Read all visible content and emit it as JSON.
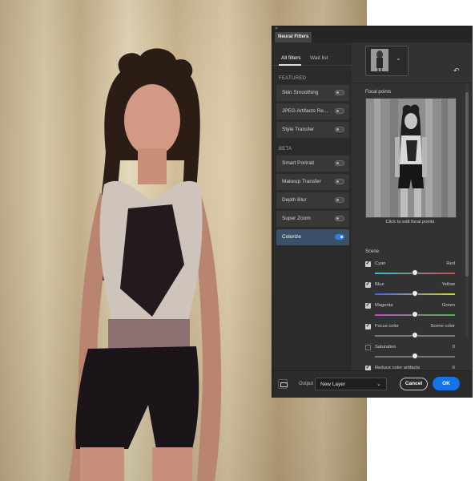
{
  "dialog": {
    "title": "Neural Filters"
  },
  "tabs": [
    {
      "label": "All filters",
      "active": true
    },
    {
      "label": "Wait list",
      "active": false
    }
  ],
  "sections": {
    "featured": "FEATURED",
    "beta": "BETA"
  },
  "featured_filters": [
    {
      "label": "Skin Smoothing",
      "on": false
    },
    {
      "label": "JPEG Artifacts Re...",
      "on": false
    },
    {
      "label": "Style Transfer",
      "on": false
    }
  ],
  "beta_filters": [
    {
      "label": "Smart Portrait",
      "on": false
    },
    {
      "label": "Makeup Transfer",
      "on": false
    },
    {
      "label": "Depth Blur",
      "on": false
    },
    {
      "label": "Super Zoom",
      "on": false
    },
    {
      "label": "Colorize",
      "on": true
    }
  ],
  "right": {
    "focal_points_label": "Focal points",
    "focal_caption": "Click to edit focal points",
    "scene_label": "Scene"
  },
  "params": [
    {
      "checked": true,
      "left": "Cyan",
      "right": "Red",
      "value_fraction": 0.5
    },
    {
      "checked": true,
      "left": "Blue",
      "right": "Yellow",
      "value_fraction": 0.5
    },
    {
      "checked": true,
      "left": "Magenta",
      "right": "Green",
      "value_fraction": 0.5
    },
    {
      "checked": true,
      "left": "Focus color",
      "right": "Scene color",
      "value_fraction": 0.5
    },
    {
      "checked": false,
      "left": "Saturation",
      "right": "0",
      "value_fraction": 0.5
    },
    {
      "checked": true,
      "left": "Reduce color artifacts",
      "right": "6",
      "value_fraction": 0.5
    }
  ],
  "footer": {
    "output_label": "Output",
    "output_value": "New Layer",
    "cancel_label": "Cancel",
    "ok_label": "OK"
  },
  "colors": {
    "accent": "#1473e6",
    "dialog_bg": "#323232",
    "selected_item": "#3c4f68"
  }
}
